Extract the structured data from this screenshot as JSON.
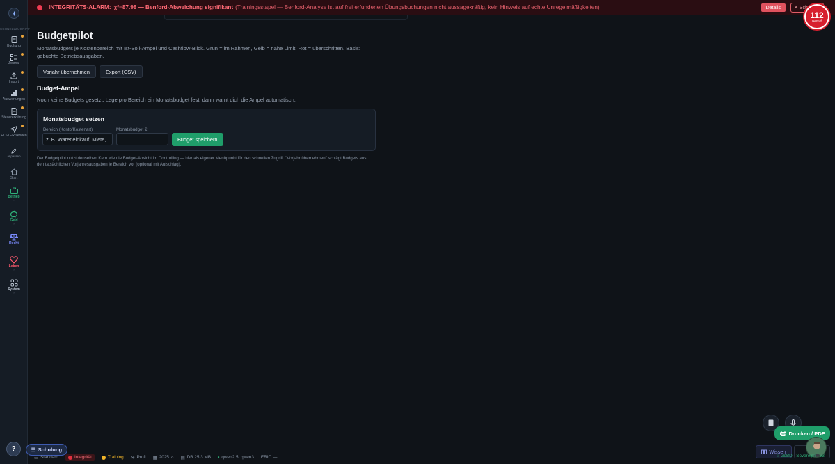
{
  "alarm": {
    "title": "INTEGRITÄTS-ALARM:",
    "chi": "χ²=87.98 — Benford-Abweichung signifikant",
    "detail": "(Trainingsstapel — Benford-Analyse ist auf frei erfundenen Übungsbuchungen nicht aussagekräftig, kein Hinweis auf echte Unregelmäßigkeiten)",
    "details_label": "Details",
    "close_label": "✕ Sch",
    "notruf_number": "112",
    "notruf_label": "Notruf"
  },
  "sidebar": {
    "quick_title": "SCHNELLZUGRIFF",
    "quick_items": [
      {
        "label": "Buchung",
        "icon": "document-icon"
      },
      {
        "label": "Journal",
        "icon": "list-icon"
      },
      {
        "label": "Import",
        "icon": "upload-icon"
      },
      {
        "label": "Auswertungen",
        "icon": "bar-chart-icon"
      },
      {
        "label": "Steuererklärung",
        "icon": "file-icon"
      },
      {
        "label": "ELSTER senden",
        "icon": "send-icon"
      },
      {
        "label": "anpassen",
        "icon": "pencil-icon"
      }
    ],
    "nav_items": [
      {
        "label": "Start",
        "icon": "home-icon",
        "color": "#8a96a6"
      },
      {
        "label": "Betrieb",
        "icon": "briefcase-icon",
        "color": "#2fb27a"
      },
      {
        "label": "Geld",
        "icon": "piggybank-icon",
        "color": "#2fb27a"
      },
      {
        "label": "Recht",
        "icon": "scales-icon",
        "color": "#7b8cff"
      },
      {
        "label": "Leben",
        "icon": "heart-icon",
        "color": "#ff5a6e"
      },
      {
        "label": "System",
        "icon": "grid-icon",
        "color": "#8a96a6"
      }
    ]
  },
  "main": {
    "title": "Budgetpilot",
    "description": "Monatsbudgets je Kostenbereich mit Ist-Soll-Ampel und Cashflow-Blick. Grün = im Rahmen, Gelb = nahe Limit, Rot = überschritten. Basis: gebuchte Betriebsausgaben.",
    "btn_vorjahr": "Vorjahr übernehmen",
    "btn_export": "Export (CSV)",
    "section_title": "Budget-Ampel",
    "empty_hint": "Noch keine Budgets gesetzt. Lege pro Bereich ein Monatsbudget fest, dann warnt dich die Ampel automatisch.",
    "card": {
      "title": "Monatsbudget setzen",
      "bereich_label": "Bereich (Konto/Kostenart)",
      "bereich_placeholder": "z. B. Wareneinkauf, Miete, …",
      "budget_label": "Monatsbudget €",
      "budget_value": "",
      "save_label": "Budget speichern"
    },
    "footnote": "Der Budgetpilot nutzt denselben Kern wie die Budget-Ansicht im Controlling — hier als eigener Menüpunkt für den schnellen Zugriff. \"Vorjahr übernehmen\" schlägt Budgets aus den tatsächlichen Vorjahresausgaben je Bereich vor (optional mit Aufschlag)."
  },
  "floating": {
    "print_label": "Drucken / PDF",
    "wissen_label": "Wissen",
    "gobd_label": "GoBD · Sovereign · v3"
  },
  "status": {
    "help_label": "?",
    "schulung_label": "Schulung",
    "standard": "Standard",
    "integritaet": "Integrität",
    "training": "Training",
    "profi": "Profi",
    "year": "2025",
    "db": "DB 25.3 MB",
    "models": "qwen2.5, qwen3",
    "eric": "ERIC —"
  },
  "colors": {
    "accent_green": "#1f9e6a",
    "alarm_red": "#ef3b52",
    "notruf_red": "#d71f2e",
    "training_yellow": "#f0b429"
  }
}
